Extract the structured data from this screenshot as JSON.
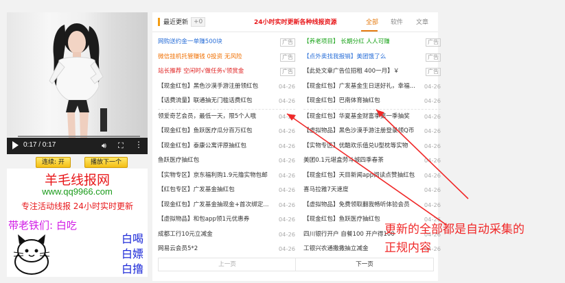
{
  "video": {
    "time": "0:17 / 0:17",
    "progress_fraction": 1.0
  },
  "buttons": {
    "continuous_play": "连续: 开",
    "play_next": "播放下一个"
  },
  "ad": {
    "title": "羊毛线报网",
    "url": "www.qq9966.com",
    "tagline": "专注活动线报 24小时实时更新",
    "lead": "带老铁们: 白吃",
    "line1": "白喝",
    "line2": "白嫖",
    "line3": "白撸"
  },
  "panel": {
    "header_title": "最近更新",
    "header_badge": "+0",
    "slogan": "24小时实时更新各种线报资源",
    "tabs": [
      "全部",
      "软件",
      "文章"
    ],
    "active_tab": "全部"
  },
  "left_items": [
    {
      "title": "网购送约金一单赚500块",
      "date": "",
      "ad": "广告",
      "color": "blue"
    },
    {
      "title": "微信挂机托管赚钱 0投资 无风险",
      "date": "",
      "ad": "广告",
      "color": "orange"
    },
    {
      "title": "站长推荐 空闲时√做任务√领赏金",
      "date": "",
      "ad": "广告",
      "color": "red"
    },
    {
      "title": "【现金红包】黑色沙漠手游注册领红包",
      "date": "04-26",
      "ad": "",
      "color": "dark"
    },
    {
      "title": "【话费流量】联通抽无门槛话费红包",
      "date": "04-26",
      "ad": "",
      "color": "dark"
    },
    {
      "title": "领爱奇艺会员，最低一天，限5个人哦",
      "date": "04-26",
      "ad": "",
      "color": "dark"
    },
    {
      "title": "【现金红包】鱼跃医疗瓜分百万红包",
      "date": "04-26",
      "ad": "",
      "color": "dark"
    },
    {
      "title": "【现金红包】泰康公寓评原抽红包",
      "date": "04-26",
      "ad": "",
      "color": "dark"
    },
    {
      "title": "鱼跃医疗抽红包",
      "date": "04-26",
      "ad": "",
      "color": "dark"
    },
    {
      "title": "【实物专区】京东福利购1.9元撸实物包邮",
      "date": "04-26",
      "ad": "",
      "color": "dark"
    },
    {
      "title": "【红包专区】广发基金抽红包",
      "date": "04-26",
      "ad": "",
      "color": "dark"
    },
    {
      "title": "【现金红包】广发基金抽现金+首次绑定...",
      "date": "04-26",
      "ad": "",
      "color": "dark"
    },
    {
      "title": "【虚拟物品】和包app领1元优惠券",
      "date": "04-26",
      "ad": "",
      "color": "dark"
    },
    {
      "title": "成都工行10元立减金",
      "date": "04-26",
      "ad": "",
      "color": "dark"
    },
    {
      "title": "网易云会员5*2",
      "date": "04-26",
      "ad": "",
      "color": "dark"
    }
  ],
  "right_items": [
    {
      "title": "【养老项目】 长期分红 人人可赚",
      "date": "",
      "ad": "广告",
      "color": "green"
    },
    {
      "title": "【点外卖找我报销】美团饿了么",
      "date": "",
      "ad": "广告",
      "color": "blue"
    },
    {
      "title": "【此处文章广告位招租 400一月】￥",
      "date": "",
      "ad": "广告",
      "color": "dark"
    },
    {
      "title": "【现金红包】广发基金生日送好礼，幸福...",
      "date": "04-26",
      "ad": "",
      "color": "dark"
    },
    {
      "title": "【现金红包】巴南体育抽红包",
      "date": "04-26",
      "ad": "",
      "color": "dark"
    },
    {
      "title": "【现金红包】华夏基金财富季第一季抽奖",
      "date": "04-26",
      "ad": "",
      "color": "dark"
    },
    {
      "title": "【虚拟物品】黑色沙漠手游注册登录领Q币",
      "date": "04-26",
      "ad": "",
      "color": "dark"
    },
    {
      "title": "【实物专区】优酷欢乐值兑U型枕等实物",
      "date": "04-26",
      "ad": "",
      "color": "dark"
    },
    {
      "title": "美团0.1元堪盒劳斗城四季春茶",
      "date": "04-26",
      "ad": "",
      "color": "dark"
    },
    {
      "title": "【现金红包】天目新闻app阅读点赞抽红包",
      "date": "04-26",
      "ad": "",
      "color": "dark"
    },
    {
      "title": "喜马拉雅7天速度",
      "date": "04-26",
      "ad": "",
      "color": "dark"
    },
    {
      "title": "【虚拟物品】免费领取翻我畅听体验会员",
      "date": "04-26",
      "ad": "",
      "color": "dark"
    },
    {
      "title": "【现金红包】鱼跃医疗抽红包",
      "date": "04-26",
      "ad": "",
      "color": "dark"
    },
    {
      "title": "四川银行开户 自餐100 开户得100",
      "date": "04-26",
      "ad": "",
      "color": "dark"
    },
    {
      "title": "工银兴农通撒撒抽立减金",
      "date": "04-26",
      "ad": "",
      "color": "dark"
    }
  ],
  "pager": {
    "prev": "上一页",
    "next": "下一页"
  },
  "annotation": {
    "line1": "更新的全部都是自动采集的",
    "line2": "正规内容",
    "color": "#f02828"
  }
}
